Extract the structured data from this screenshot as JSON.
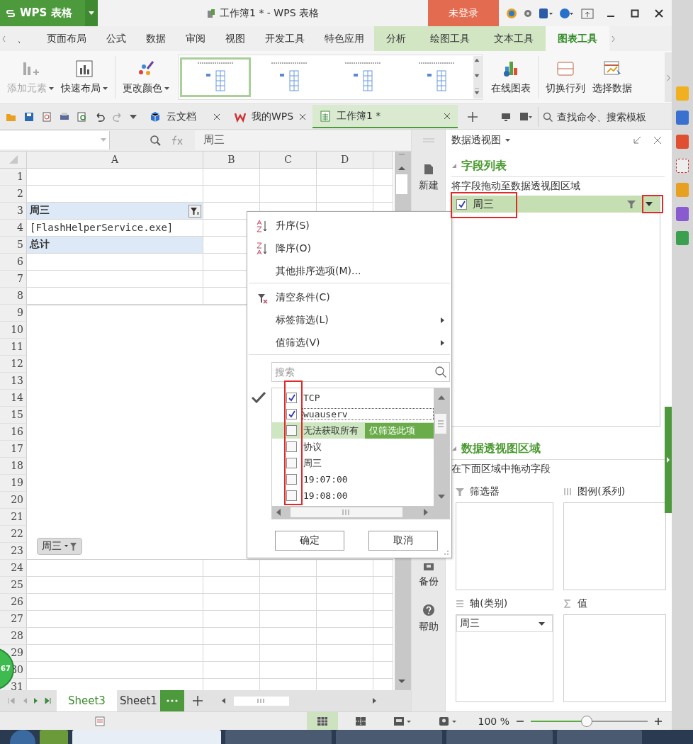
{
  "title_bar": {
    "app_name": "WPS 表格",
    "title": "工作簿1 * - WPS 表格",
    "login": "未登录"
  },
  "ribbon_tabs": [
    {
      "label": "、",
      "selected": false,
      "context": false
    },
    {
      "label": "页面布局",
      "selected": false,
      "context": false
    },
    {
      "label": "公式",
      "selected": false,
      "context": false
    },
    {
      "label": "数据",
      "selected": false,
      "context": false
    },
    {
      "label": "审阅",
      "selected": false,
      "context": false
    },
    {
      "label": "视图",
      "selected": false,
      "context": false
    },
    {
      "label": "开发工具",
      "selected": false,
      "context": false
    },
    {
      "label": "特色应用",
      "selected": false,
      "context": false
    },
    {
      "label": "分析",
      "selected": false,
      "context": true
    },
    {
      "label": "绘图工具",
      "selected": false,
      "context": true
    },
    {
      "label": "文本工具",
      "selected": false,
      "context": true
    },
    {
      "label": "图表工具",
      "selected": true,
      "context": true
    }
  ],
  "ribbon": {
    "left": [
      {
        "label": "添加元素",
        "disabled": true,
        "dropdown": true
      },
      {
        "label": "快速布局",
        "disabled": false,
        "dropdown": true
      },
      {
        "label": "更改颜色",
        "disabled": false,
        "dropdown": true
      }
    ],
    "styles": [
      {
        "selected": true
      },
      {
        "selected": false
      },
      {
        "selected": false
      },
      {
        "selected": false
      }
    ],
    "right": [
      {
        "label": "在线图表"
      },
      {
        "label": "切换行列"
      },
      {
        "label": "选择数据"
      }
    ]
  },
  "doc_tabs": [
    {
      "label": "云文档",
      "selected": false
    },
    {
      "label": "我的WPS",
      "selected": false
    },
    {
      "label": "工作簿1 *",
      "selected": true
    }
  ],
  "command_search": {
    "placeholder": "查找命令、搜索模板"
  },
  "formula_bar": {
    "value": "周三"
  },
  "sheet": {
    "columns": [
      "A",
      "B",
      "C",
      "D"
    ],
    "row_numbers": [
      "1",
      "2",
      "3",
      "4",
      "5",
      "6",
      "7",
      "8",
      "9",
      "10",
      "11",
      "12",
      "13",
      "14",
      "15",
      "16",
      "17",
      "18",
      "19",
      "20",
      "21",
      "22",
      "23",
      "24",
      "25",
      "26",
      "27",
      "28",
      "29",
      "30",
      "31"
    ],
    "pivot_rows": [
      {
        "text": "周三",
        "kind": "field_header"
      },
      {
        "text": "[FlashHelperService.exe]",
        "kind": "item"
      },
      {
        "text": "总计",
        "kind": "total"
      }
    ],
    "chart_field_button": "周三",
    "floating_badge": "67"
  },
  "filter_menu": {
    "items": [
      {
        "label": "升序(S)",
        "kind": "sort_asc",
        "submenu": false,
        "divider_after": false
      },
      {
        "label": "降序(O)",
        "kind": "sort_desc",
        "submenu": false,
        "divider_after": false
      },
      {
        "label": "其他排序选项(M)...",
        "kind": "plain",
        "submenu": false,
        "divider_after": true
      },
      {
        "label": "清空条件(C)",
        "kind": "clear",
        "submenu": false,
        "divider_after": false
      },
      {
        "label": "标签筛选(L)",
        "kind": "plain",
        "submenu": true,
        "divider_after": false
      },
      {
        "label": "值筛选(V)",
        "kind": "plain",
        "submenu": true,
        "divider_after": true
      }
    ],
    "search": {
      "placeholder": "搜索"
    },
    "values": [
      {
        "label": "TCP",
        "checked": true,
        "focused": false
      },
      {
        "label": "wuauserv",
        "checked": true,
        "focused": true
      },
      {
        "label": "无法获取所有",
        "checked": false,
        "focused": false,
        "hover_action": "仅筛选此项"
      },
      {
        "label": "协议",
        "checked": false,
        "focused": false
      },
      {
        "label": "周三",
        "checked": false,
        "focused": false
      },
      {
        "label": "19:07:00",
        "checked": false,
        "focused": false
      },
      {
        "label": "19:08:00",
        "checked": false,
        "focused": false
      }
    ],
    "buttons": [
      "确定",
      "取消"
    ]
  },
  "side_strip": [
    {
      "label": "新建"
    },
    {
      "label": "备份"
    },
    {
      "label": "帮助"
    }
  ],
  "pivot_panel": {
    "title": "数据透视图",
    "field_section": {
      "title": "字段列表",
      "expanded": true,
      "hint": "将字段拖动至数据透视图区域",
      "fields": [
        {
          "label": "周三",
          "checked": true
        }
      ]
    },
    "area_section": {
      "title": "数据透视图区域",
      "expanded": true,
      "hint": "在下面区域中拖动字段",
      "areas": [
        {
          "label": "筛选器"
        },
        {
          "label": "图例(系列)"
        },
        {
          "label": "轴(类别)",
          "fields": [
            "周三"
          ]
        },
        {
          "label": "值"
        }
      ]
    }
  },
  "sheet_tabs": [
    {
      "label": "Sheet3",
      "selected": true
    },
    {
      "label": "Sheet1",
      "selected": false
    }
  ],
  "status_bar": {
    "views": [
      {
        "selected": true
      },
      {
        "selected": false
      },
      {
        "selected": false
      },
      {
        "selected": false
      }
    ],
    "zoom": "100 %",
    "level": 0.48
  }
}
